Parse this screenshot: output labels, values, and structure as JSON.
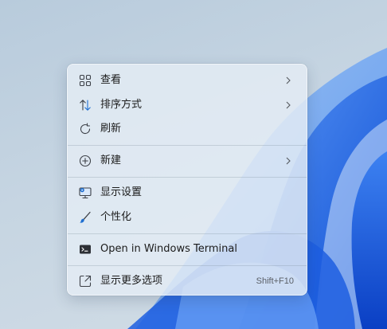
{
  "menu": {
    "items": [
      {
        "label": "查看",
        "icon": "grid-view-icon",
        "has_submenu": true
      },
      {
        "label": "排序方式",
        "icon": "sort-arrows-icon",
        "has_submenu": true
      },
      {
        "label": "刷新",
        "icon": "refresh-icon",
        "has_submenu": false
      },
      {
        "label": "新建",
        "icon": "add-circle-icon",
        "has_submenu": true
      },
      {
        "label": "显示设置",
        "icon": "display-settings-icon",
        "has_submenu": false
      },
      {
        "label": "个性化",
        "icon": "paintbrush-icon",
        "has_submenu": false
      },
      {
        "label": "Open in Windows Terminal",
        "icon": "terminal-icon",
        "has_submenu": false
      },
      {
        "label": "显示更多选项",
        "icon": "show-more-options-icon",
        "has_submenu": false,
        "shortcut": "Shift+F10"
      }
    ]
  },
  "colors": {
    "menu_background": "#e4ecf4",
    "text": "#1b1b1b",
    "icon_stroke": "#3c4047",
    "accent_blue": "#1f6fd1",
    "wallpaper_blue": "#1e66e8"
  }
}
